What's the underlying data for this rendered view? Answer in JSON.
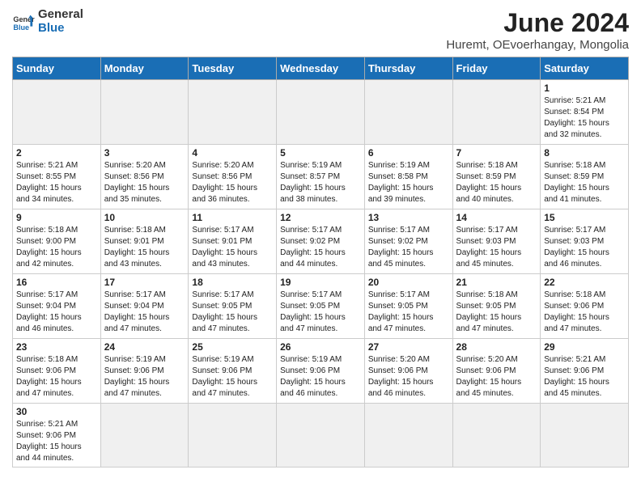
{
  "logo": {
    "line1": "General",
    "line2": "Blue"
  },
  "title": "June 2024",
  "subtitle": "Huremt, OEvoerhangay, Mongolia",
  "weekdays": [
    "Sunday",
    "Monday",
    "Tuesday",
    "Wednesday",
    "Thursday",
    "Friday",
    "Saturday"
  ],
  "weeks": [
    [
      {
        "day": "",
        "info": ""
      },
      {
        "day": "",
        "info": ""
      },
      {
        "day": "",
        "info": ""
      },
      {
        "day": "",
        "info": ""
      },
      {
        "day": "",
        "info": ""
      },
      {
        "day": "",
        "info": ""
      },
      {
        "day": "1",
        "info": "Sunrise: 5:21 AM\nSunset: 8:54 PM\nDaylight: 15 hours\nand 32 minutes."
      }
    ],
    [
      {
        "day": "2",
        "info": "Sunrise: 5:21 AM\nSunset: 8:55 PM\nDaylight: 15 hours\nand 34 minutes."
      },
      {
        "day": "3",
        "info": "Sunrise: 5:20 AM\nSunset: 8:56 PM\nDaylight: 15 hours\nand 35 minutes."
      },
      {
        "day": "4",
        "info": "Sunrise: 5:20 AM\nSunset: 8:56 PM\nDaylight: 15 hours\nand 36 minutes."
      },
      {
        "day": "5",
        "info": "Sunrise: 5:19 AM\nSunset: 8:57 PM\nDaylight: 15 hours\nand 38 minutes."
      },
      {
        "day": "6",
        "info": "Sunrise: 5:19 AM\nSunset: 8:58 PM\nDaylight: 15 hours\nand 39 minutes."
      },
      {
        "day": "7",
        "info": "Sunrise: 5:18 AM\nSunset: 8:59 PM\nDaylight: 15 hours\nand 40 minutes."
      },
      {
        "day": "8",
        "info": "Sunrise: 5:18 AM\nSunset: 8:59 PM\nDaylight: 15 hours\nand 41 minutes."
      }
    ],
    [
      {
        "day": "9",
        "info": "Sunrise: 5:18 AM\nSunset: 9:00 PM\nDaylight: 15 hours\nand 42 minutes."
      },
      {
        "day": "10",
        "info": "Sunrise: 5:18 AM\nSunset: 9:01 PM\nDaylight: 15 hours\nand 43 minutes."
      },
      {
        "day": "11",
        "info": "Sunrise: 5:17 AM\nSunset: 9:01 PM\nDaylight: 15 hours\nand 43 minutes."
      },
      {
        "day": "12",
        "info": "Sunrise: 5:17 AM\nSunset: 9:02 PM\nDaylight: 15 hours\nand 44 minutes."
      },
      {
        "day": "13",
        "info": "Sunrise: 5:17 AM\nSunset: 9:02 PM\nDaylight: 15 hours\nand 45 minutes."
      },
      {
        "day": "14",
        "info": "Sunrise: 5:17 AM\nSunset: 9:03 PM\nDaylight: 15 hours\nand 45 minutes."
      },
      {
        "day": "15",
        "info": "Sunrise: 5:17 AM\nSunset: 9:03 PM\nDaylight: 15 hours\nand 46 minutes."
      }
    ],
    [
      {
        "day": "16",
        "info": "Sunrise: 5:17 AM\nSunset: 9:04 PM\nDaylight: 15 hours\nand 46 minutes."
      },
      {
        "day": "17",
        "info": "Sunrise: 5:17 AM\nSunset: 9:04 PM\nDaylight: 15 hours\nand 47 minutes."
      },
      {
        "day": "18",
        "info": "Sunrise: 5:17 AM\nSunset: 9:05 PM\nDaylight: 15 hours\nand 47 minutes."
      },
      {
        "day": "19",
        "info": "Sunrise: 5:17 AM\nSunset: 9:05 PM\nDaylight: 15 hours\nand 47 minutes."
      },
      {
        "day": "20",
        "info": "Sunrise: 5:17 AM\nSunset: 9:05 PM\nDaylight: 15 hours\nand 47 minutes."
      },
      {
        "day": "21",
        "info": "Sunrise: 5:18 AM\nSunset: 9:05 PM\nDaylight: 15 hours\nand 47 minutes."
      },
      {
        "day": "22",
        "info": "Sunrise: 5:18 AM\nSunset: 9:06 PM\nDaylight: 15 hours\nand 47 minutes."
      }
    ],
    [
      {
        "day": "23",
        "info": "Sunrise: 5:18 AM\nSunset: 9:06 PM\nDaylight: 15 hours\nand 47 minutes."
      },
      {
        "day": "24",
        "info": "Sunrise: 5:19 AM\nSunset: 9:06 PM\nDaylight: 15 hours\nand 47 minutes."
      },
      {
        "day": "25",
        "info": "Sunrise: 5:19 AM\nSunset: 9:06 PM\nDaylight: 15 hours\nand 47 minutes."
      },
      {
        "day": "26",
        "info": "Sunrise: 5:19 AM\nSunset: 9:06 PM\nDaylight: 15 hours\nand 46 minutes."
      },
      {
        "day": "27",
        "info": "Sunrise: 5:20 AM\nSunset: 9:06 PM\nDaylight: 15 hours\nand 46 minutes."
      },
      {
        "day": "28",
        "info": "Sunrise: 5:20 AM\nSunset: 9:06 PM\nDaylight: 15 hours\nand 45 minutes."
      },
      {
        "day": "29",
        "info": "Sunrise: 5:21 AM\nSunset: 9:06 PM\nDaylight: 15 hours\nand 45 minutes."
      }
    ],
    [
      {
        "day": "30",
        "info": "Sunrise: 5:21 AM\nSunset: 9:06 PM\nDaylight: 15 hours\nand 44 minutes."
      },
      {
        "day": "",
        "info": ""
      },
      {
        "day": "",
        "info": ""
      },
      {
        "day": "",
        "info": ""
      },
      {
        "day": "",
        "info": ""
      },
      {
        "day": "",
        "info": ""
      },
      {
        "day": "",
        "info": ""
      }
    ]
  ]
}
